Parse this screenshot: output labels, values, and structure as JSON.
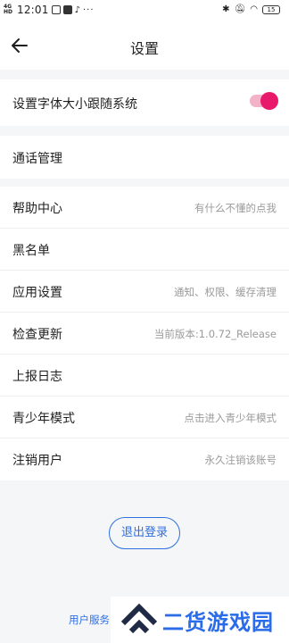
{
  "status_bar": {
    "network": "4G HD",
    "time": "12:01",
    "battery": "15",
    "dots": "···"
  },
  "header": {
    "title": "设置"
  },
  "settings": {
    "font_follow_system": {
      "label": "设置字体大小跟随系统",
      "enabled": true
    },
    "call_management": {
      "label": "通话管理"
    },
    "help_center": {
      "label": "帮助中心",
      "hint": "有什么不懂的点我"
    },
    "blacklist": {
      "label": "黑名单"
    },
    "app_settings": {
      "label": "应用设置",
      "hint": "通知、权限、缓存清理"
    },
    "check_update": {
      "label": "检查更新",
      "hint": "当前版本:1.0.72_Release"
    },
    "report_log": {
      "label": "上报日志"
    },
    "teen_mode": {
      "label": "青少年模式",
      "hint": "点击进入青少年模式"
    },
    "cancel_account": {
      "label": "注销用户",
      "hint": "永久注销该账号"
    }
  },
  "logout_label": "退出登录",
  "agreement_link": "用户服务",
  "watermark_text": "二货游戏园",
  "colors": {
    "accent": "#2f6fe0",
    "toggle_on": "#e8196a",
    "hint_text": "#9a9a9a",
    "background": "#f5f6f8"
  }
}
